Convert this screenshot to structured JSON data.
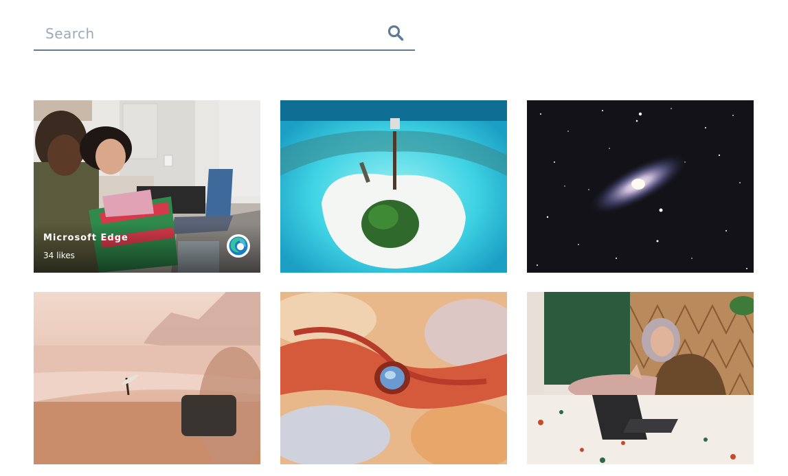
{
  "search": {
    "placeholder": "Search",
    "value": "",
    "icon": "search-icon"
  },
  "gallery": {
    "tiles": [
      {
        "subject": "friends-shopping-laptop",
        "overlay": {
          "title": "Microsoft Edge",
          "likes": "34 likes",
          "logo": "edge-logo-icon"
        }
      },
      {
        "subject": "tropical-island-aerial"
      },
      {
        "subject": "galaxy-night-sky"
      },
      {
        "subject": "misty-beach-surfer"
      },
      {
        "subject": "abstract-aerial-landscape"
      },
      {
        "subject": "woman-video-call-tablet"
      }
    ]
  },
  "colors": {
    "search_underline": "#5f7a94",
    "search_icon": "#5f7a94",
    "placeholder": "#9aaabb",
    "background": "#ffffff"
  }
}
